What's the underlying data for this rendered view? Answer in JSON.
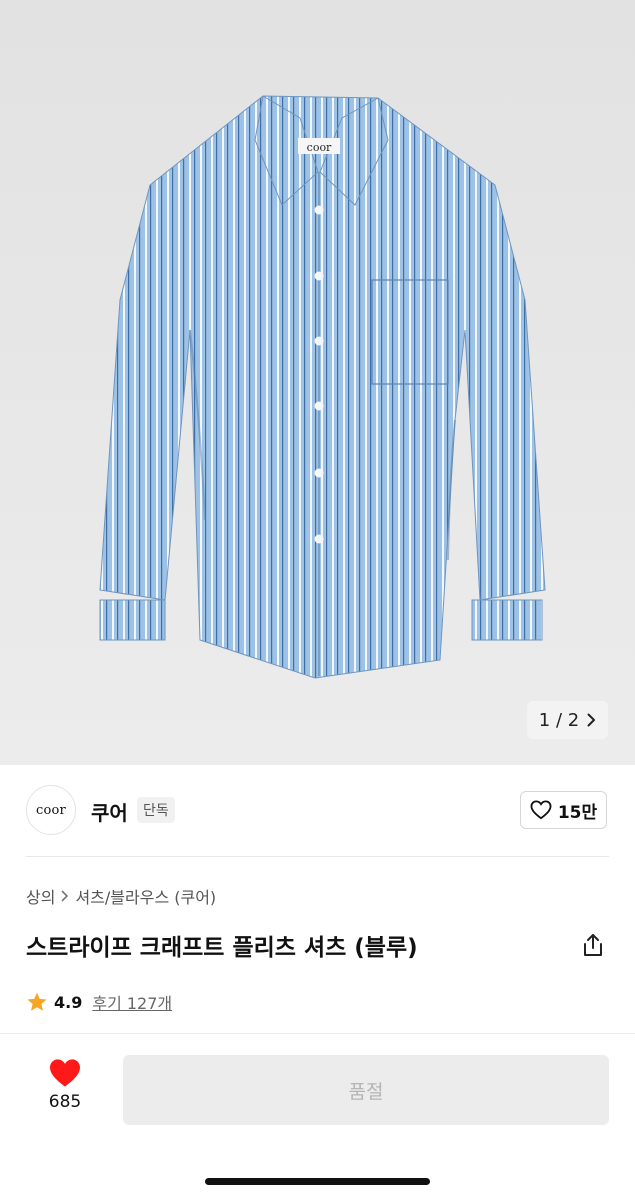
{
  "gallery": {
    "page_indicator": "1 / 2",
    "next_icon": "chevron-right-icon",
    "label_text": "coor"
  },
  "seller": {
    "logo_text": "coor",
    "name": "쿠어",
    "badge": "단독",
    "like_icon": "heart-outline-icon",
    "like_count": "15만"
  },
  "product": {
    "breadcrumb": [
      "상의",
      "셔츠/블라우스 (쿠어)"
    ],
    "title": "스트라이프 크래프트 플리츠 셔츠 (블루)",
    "share_icon": "share-icon",
    "rating": "4.9",
    "reviews": "후기 127개",
    "rating_star_color": "#f5a623"
  },
  "action_bar": {
    "wish_count": "685",
    "wish_color": "#ff1a1a",
    "buy_label": "품절"
  }
}
